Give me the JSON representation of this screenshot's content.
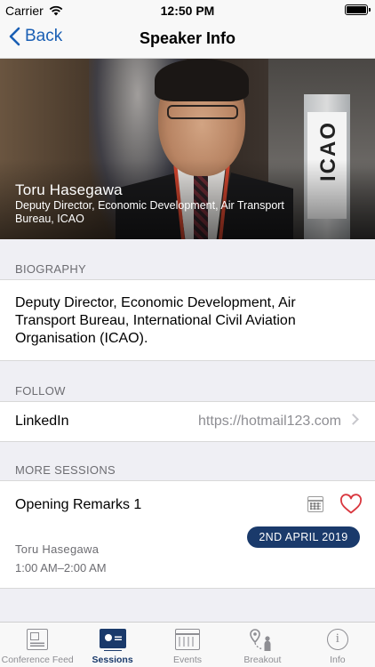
{
  "status_bar": {
    "carrier": "Carrier",
    "time": "12:50 PM"
  },
  "nav": {
    "back_label": "Back",
    "title": "Speaker Info"
  },
  "speaker": {
    "name": "Toru  Hasegawa",
    "role": "Deputy Director, Economic Development, Air Transport Bureau, ICAO",
    "photo_sign_text": "ICAO"
  },
  "biography": {
    "header": "BIOGRAPHY",
    "text": "Deputy Director, Economic Development, Air Transport Bureau, International Civil Aviation Organisation (ICAO)."
  },
  "follow": {
    "header": "FOLLOW",
    "label": "LinkedIn",
    "url": "https://hotmail123.com"
  },
  "more_sessions": {
    "header": "MORE SESSIONS",
    "sessions": [
      {
        "title": "Opening Remarks 1",
        "date": "2ND APRIL 2019",
        "speaker": "Toru  Hasegawa",
        "time": "1:00 AM–2:00 AM",
        "favorite": false
      }
    ]
  },
  "tabs": [
    {
      "label": "Conference Feed",
      "icon": "newspaper-icon",
      "active": false
    },
    {
      "label": "Sessions",
      "icon": "presentation-icon",
      "active": true
    },
    {
      "label": "Events",
      "icon": "calendar-icon",
      "active": false
    },
    {
      "label": "Breakout",
      "icon": "location-person-icon",
      "active": false
    },
    {
      "label": "Info",
      "icon": "info-icon",
      "active": false
    }
  ],
  "colors": {
    "accent": "#1a5fb4",
    "brand_navy": "#1a3a6b",
    "heart": "#d9363e"
  }
}
